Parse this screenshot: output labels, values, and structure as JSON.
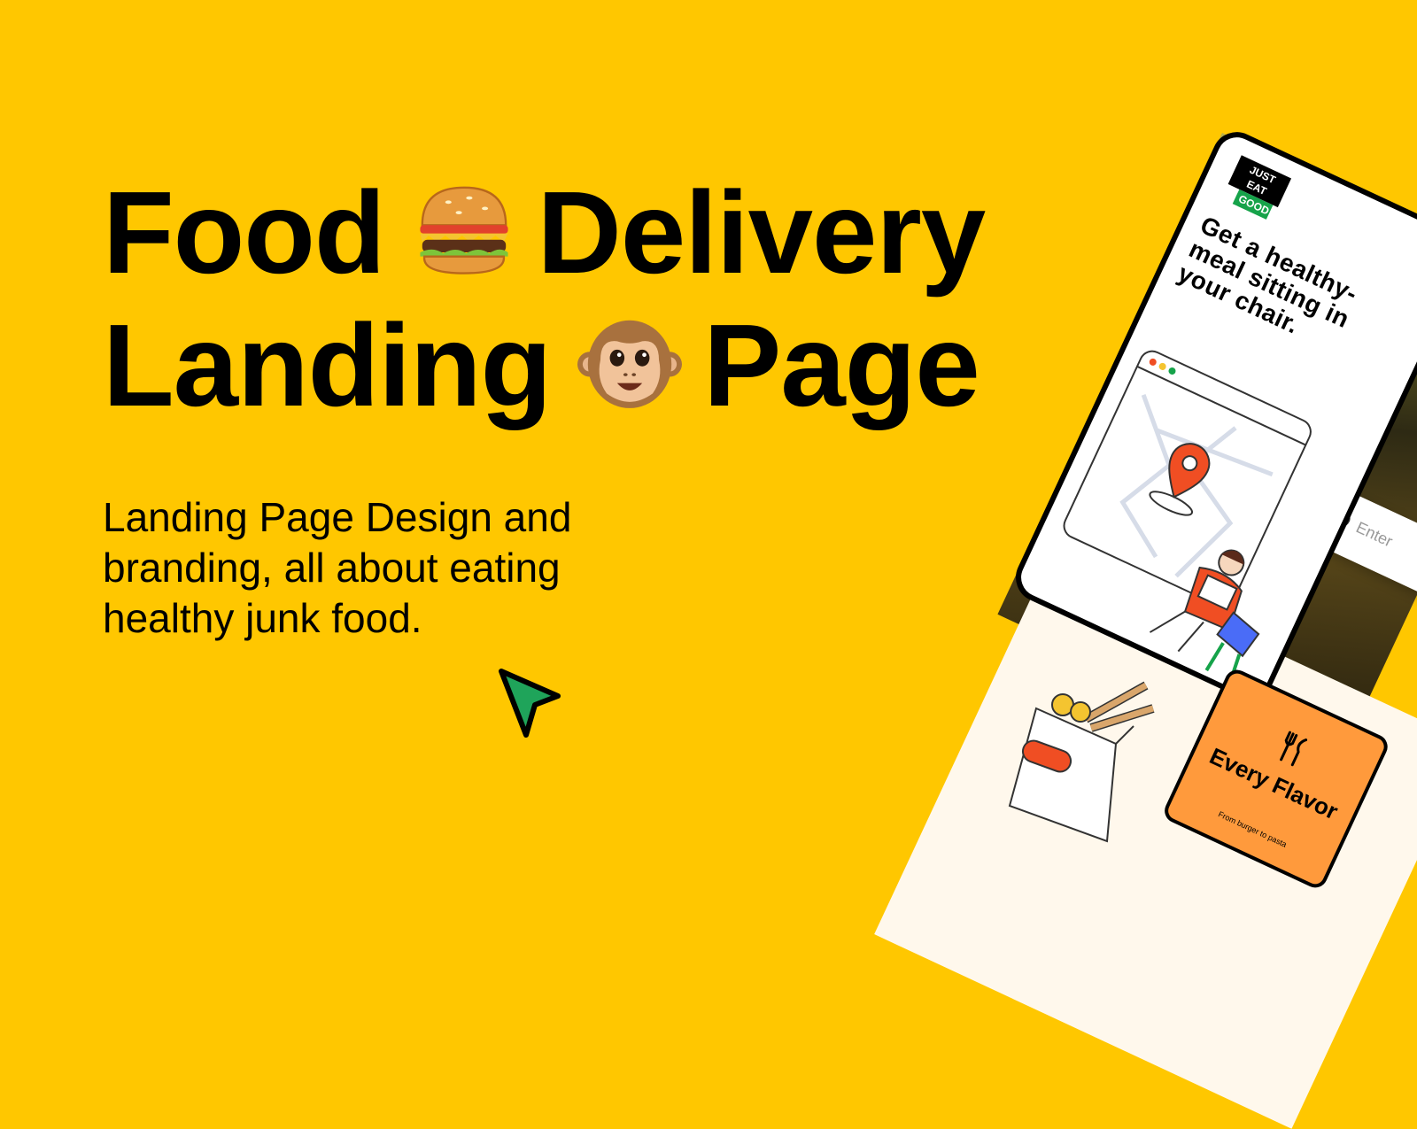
{
  "hero": {
    "line1_word1": "Food",
    "line1_word2": "Delivery",
    "line2_word1": "Landing",
    "line2_word2": "Page",
    "emoji1": "burger-icon",
    "emoji2": "monkey-icon",
    "subtitle": "Landing Page Design and branding, all about eating healthy junk food."
  },
  "mockup": {
    "logo_line1": "JUST EAT",
    "logo_line2": "GOOD",
    "headline": "Get a healthy-meal sitting in your chair.",
    "address_placeholder": "Enter",
    "feature_title": "Every Flavor",
    "feature_sub": "From burger to pasta"
  },
  "colors": {
    "background": "#FFC700",
    "accent_green": "#16A34A",
    "accent_orange": "#FF9A3C",
    "pin_red": "#F04E23"
  }
}
